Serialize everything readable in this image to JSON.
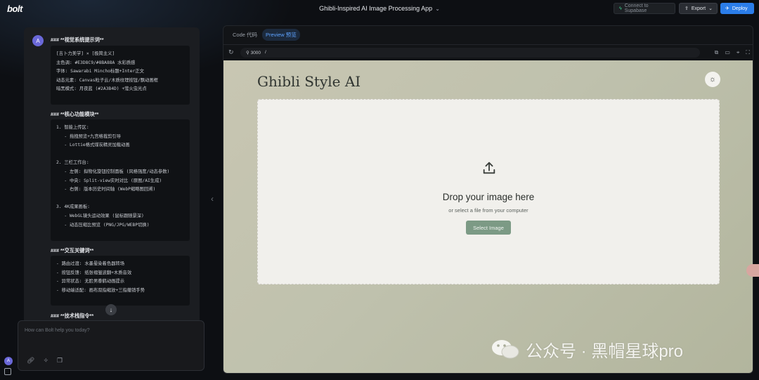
{
  "header": {
    "logo": "bolt",
    "project_title": "Ghibli-Inspired AI Image Processing App",
    "connect_label": "Connect to Supabase",
    "export_label": "Export",
    "deploy_label": "Deploy"
  },
  "chat": {
    "avatar_letter": "A",
    "sections": [
      {
        "heading": "### **视觉系统提示词**",
        "code": "[吉卜力美学] × [极简主义]\n主色调: #E3D8C9/#8BA88A 水彩质感\n字体: Sawarabi Mincho标题+Inter正文\n动态元素: Canvas粒子云/木质纹理按钮/飘动画框\n暗黑模式: 月夜蓝 (#2A3B4D) +萤火虫光点"
      },
      {
        "heading": "### **核心功能模块**",
        "code": "1. 智能上传区:\n   - 拖拽预览+九宫格裁剪引导\n   - Lottie格式煤炭精灵加载动画\n\n2. 三栏工作台:\n   - 左侧: 拟物化旋钮控制面板 (风格强度/动态参数)\n   - 中央: Split-view实时对比 (原图/AI生成)\n   - 右侧: 版本历史时间轴 (WebP缩略图回溯)\n\n3. 4K成果画板:\n   - WebGL镜头运动效果 (鼠标跟随景深)\n   - 动态压缩比预览 (PNG/JPG/WEBP切换)"
      },
      {
        "heading": "### **交互关键词**",
        "code": "- 路由过渡: 水墨晕染着色器转场\n- 按钮反馈: 纸张褶皱波翻+木质音效\n- 异常状态: 无脸男眷鹤动画提示\n- 移动端适配: 画布双指缩放+三指撤销手势"
      },
      {
        "heading": "### **技术栈指令**"
      }
    ],
    "input_placeholder": "How can Bolt help you today?",
    "user_initial": "A"
  },
  "preview": {
    "tabs": [
      {
        "label": "Code 代码",
        "active": false
      },
      {
        "label": "Preview 预览",
        "active": true
      }
    ],
    "port": "3000",
    "path": "/",
    "app": {
      "title": "Ghibli Style AI",
      "drop_title": "Drop your image here",
      "drop_subtitle": "or select a file from your computer",
      "select_button": "Select Image"
    }
  },
  "watermark": {
    "text": "公众号 · 黑帽星球pro"
  },
  "icons": [
    "bolt-logo",
    "chevron-down-icon",
    "supabase-icon",
    "export-icon",
    "deploy-icon",
    "link-icon",
    "sparkle-icon",
    "chat-icon",
    "refresh-icon",
    "external-link-icon",
    "devices-icon",
    "picker-icon",
    "fullscreen-icon",
    "sun-icon",
    "upload-icon",
    "arrow-down-icon",
    "chevron-left-icon",
    "sidebar-icon"
  ],
  "colors": {
    "deploy": "#2b7de9",
    "accent_tab": "#5ea3ff",
    "select_button": "#7c9a85",
    "avatar": "#6a68d8"
  }
}
